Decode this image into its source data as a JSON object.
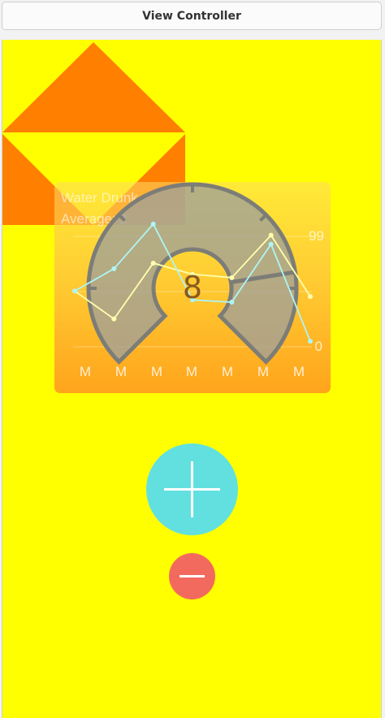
{
  "window": {
    "title": "View Controller"
  },
  "colors": {
    "canvas_background": "#ffff00",
    "shape_orange": "#ff7f00",
    "gauge_fill": "#9fa09a",
    "gauge_stroke": "#7d7d77",
    "line_color": "#aef5f5",
    "point_color": "#ffffb0",
    "add_button": "#62e0e0",
    "remove_button": "#f26a5e"
  },
  "chart_card": {
    "title": "Water Drunk",
    "subtitle": "Average: 2",
    "y_max_label": "99",
    "y_min_label": "0",
    "x_labels": [
      "M",
      "M",
      "M",
      "M",
      "M",
      "M",
      "M"
    ]
  },
  "chart_data": {
    "type": "line",
    "title": "Water Drunk",
    "subtitle": "Average: 2",
    "categories": [
      "M",
      "M",
      "M",
      "M",
      "M",
      "M",
      "M"
    ],
    "series": [
      {
        "values": [
          50,
          25,
          75,
          65,
          62,
          100,
          45
        ]
      },
      {
        "values": [
          50,
          70,
          110,
          42,
          40,
          92,
          5
        ]
      }
    ],
    "y_tick_labels": [
      "99",
      "0"
    ],
    "grid": true
  },
  "gauge": {
    "value": "8",
    "level": 0.8
  },
  "buttons": {
    "add": {
      "icon": "plus-icon"
    },
    "remove": {
      "icon": "minus-icon"
    }
  }
}
